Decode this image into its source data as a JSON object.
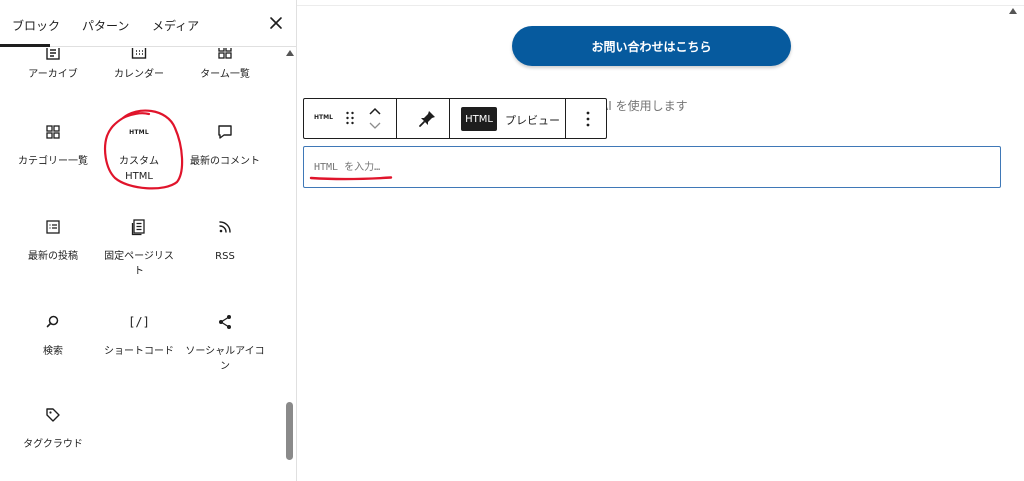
{
  "tabs": [
    {
      "label": "ブロック",
      "active": true
    },
    {
      "label": "パターン",
      "active": false
    },
    {
      "label": "メディア",
      "active": false
    }
  ],
  "close_symbol": "×",
  "blocks": [
    {
      "label": "アーカイブ",
      "icon": "archive-icon"
    },
    {
      "label": "カレンダー",
      "icon": "calendar-icon"
    },
    {
      "label": "ターム一覧",
      "icon": "grid-icon"
    },
    {
      "label": "カテゴリー一覧",
      "icon": "categories-icon"
    },
    {
      "label": "カスタム HTML",
      "icon": "html-icon",
      "icon_text": "HTML"
    },
    {
      "label": "最新のコメント",
      "icon": "comment-icon"
    },
    {
      "label": "最新の投稿",
      "icon": "post-list-icon"
    },
    {
      "label": "固定ページリスト",
      "icon": "pages-icon"
    },
    {
      "label": "RSS",
      "icon": "rss-icon"
    },
    {
      "label": "検索",
      "icon": "search-icon"
    },
    {
      "label": "ショートコード",
      "icon": "shortcode-icon",
      "icon_text": "[/]"
    },
    {
      "label": "ソーシャルアイコン",
      "icon": "share-icon"
    },
    {
      "label": "タグクラウド",
      "icon": "tag-icon"
    }
  ],
  "editor": {
    "contact_button_label": "お問い合わせはこちら",
    "background_text": "AI を使用します",
    "toolbar": {
      "block_icon_text": "HTML",
      "html_tab_label": "HTML",
      "preview_label": "プレビュー"
    },
    "html_input_placeholder": "HTML を入力…"
  },
  "colors": {
    "accent_blue": "#065a9e",
    "focus_border": "#3f78b7",
    "annotation_red": "#e0142b",
    "text": "#1e1e1e"
  }
}
